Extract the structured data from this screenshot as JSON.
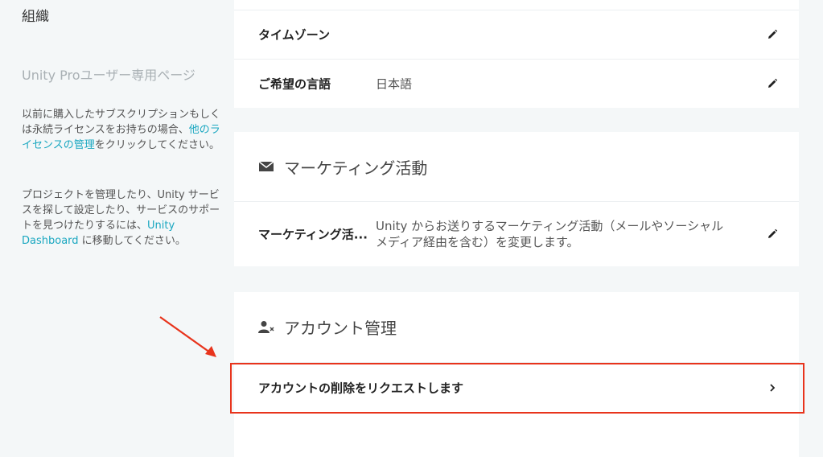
{
  "sidebar": {
    "title": "組織",
    "subtitle": "Unity Proユーザー専用ページ",
    "para1": {
      "before": "以前に購入したサブスクリプションもしくは永続ライセンスをお持ちの場合、",
      "link": "他のライセンスの管理",
      "after": "をクリックしてください。"
    },
    "para2": {
      "before": "プロジェクトを管理したり、Unity サービスを探して設定したり、サービスのサポートを見つけたりするには、",
      "link": "Unity Dashboard",
      "after": " に移動してください。"
    }
  },
  "settings": {
    "rows": [
      {
        "label": "タイムゾーン",
        "value": ""
      },
      {
        "label": "ご希望の言語",
        "value": "日本語"
      }
    ]
  },
  "marketing": {
    "title": "マーケティング活動",
    "row_label": "マーケティング活...",
    "row_value": "Unity からお送りするマーケティング活動（メールやソーシャルメディア経由を含む）を変更します。"
  },
  "account": {
    "title": "アカウント管理",
    "delete_label": "アカウントの削除をリクエストします"
  },
  "colors": {
    "highlight": "#e8341c",
    "link": "#1aa7c0",
    "background": "#f4f7f8"
  },
  "icons": [
    "edit-pencil-icon",
    "envelope-icon",
    "user-remove-icon",
    "chevron-right-icon",
    "annotation-arrow"
  ]
}
